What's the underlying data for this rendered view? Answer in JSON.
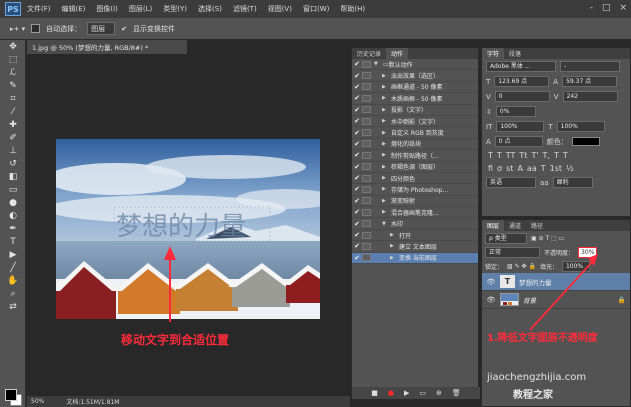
{
  "menubar": {
    "logo": "PS",
    "items": [
      "文件(F)",
      "编辑(E)",
      "图像(I)",
      "图层(L)",
      "类型(Y)",
      "选择(S)",
      "滤镜(T)",
      "视图(V)",
      "窗口(W)",
      "帮助(H)"
    ],
    "win_controls": [
      "-",
      "□",
      "×"
    ]
  },
  "options": {
    "auto_select_label": "自动选择：",
    "auto_select_value": "图层",
    "show_transform_label": "显示变换控件"
  },
  "document": {
    "tab_title": "1.jpg @ 50% (梦想的力量, RGB/8#) *",
    "zoom": "50%",
    "doc_size": "文档:1.51M/1.81M",
    "overlay_text": "梦想的力量",
    "annotation": "移动文字到合适位置"
  },
  "actions": {
    "tabs": [
      "历史记录",
      "动作"
    ],
    "items": [
      {
        "label": "默认动作",
        "level": 0,
        "folder": true
      },
      {
        "label": "淡出效果（选区）",
        "level": 1
      },
      {
        "label": "画框通道 - 50 像素",
        "level": 1
      },
      {
        "label": "木质画框 - 50 像素",
        "level": 1
      },
      {
        "label": "投影（文字）",
        "level": 1
      },
      {
        "label": "水中倒影（文字）",
        "level": 1
      },
      {
        "label": "自定义 RGB 到灰度",
        "level": 1
      },
      {
        "label": "熔化的铅块",
        "level": 1
      },
      {
        "label": "制作剪贴路径（...",
        "level": 1
      },
      {
        "label": "棕褐色调（图层）",
        "level": 1
      },
      {
        "label": "四分颜色",
        "level": 1
      },
      {
        "label": "存储为 Photoshop...",
        "level": 1
      },
      {
        "label": "渐变映射",
        "level": 1
      },
      {
        "label": "混合器画笔克隆...",
        "level": 1
      },
      {
        "label": "水印",
        "level": 1,
        "expanded": true
      },
      {
        "label": "打开",
        "level": 2
      },
      {
        "label": "建立 文本图层",
        "level": 2
      },
      {
        "label": "变换 当前图层",
        "level": 2,
        "highlight": true
      }
    ]
  },
  "character": {
    "tabs": [
      "字符",
      "段落"
    ],
    "font_family": "Adobe 黑体 ...",
    "font_style": "-",
    "size": "123.69 点",
    "leading": "59.37 点",
    "kerning": "0",
    "tracking": "242",
    "scale_pct": "0%",
    "vscale": "100%",
    "hscale": "100%",
    "baseline": "0 点",
    "color_label": "颜色：",
    "language": "英语",
    "aa_label": "aa",
    "aa_value": "犀利",
    "type_buttons": [
      "T",
      "T",
      "TT",
      "Tt",
      "T'",
      "T,",
      "T",
      "T"
    ],
    "extra_buttons": [
      "fi",
      "σ",
      "st",
      "A",
      "aa",
      "T",
      "1st",
      "½"
    ]
  },
  "layers": {
    "tabs": [
      "图层",
      "通道",
      "路径"
    ],
    "filter_label": "ρ 类型",
    "blend_mode": "正常",
    "opacity_label": "不透明度：",
    "opacity_value": "30%",
    "lock_label": "锁定：",
    "fill_label": "填充：",
    "fill_value": "100%",
    "items": [
      {
        "name": "梦想的力量",
        "type": "text",
        "selected": true
      },
      {
        "name": "背景",
        "type": "image",
        "selected": false
      }
    ],
    "annotation": "1.降低文字图层不透明度"
  },
  "watermark": {
    "url": "jiaochengzhijia.com",
    "cn": "教程之家"
  },
  "colors": {
    "accent_red": "#ff2b3a",
    "selection_blue": "#5f80a8"
  }
}
